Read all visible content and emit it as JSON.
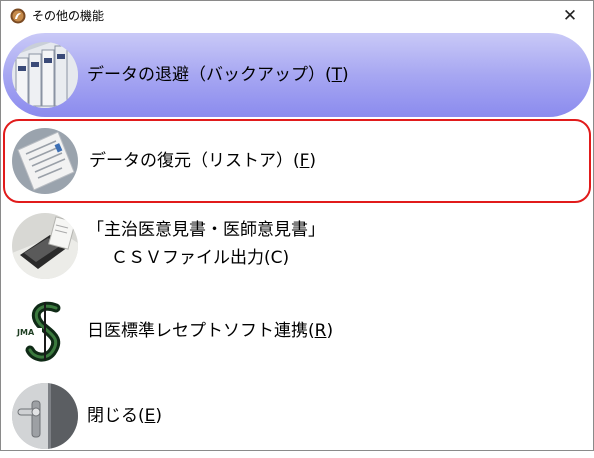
{
  "window": {
    "title": "その他の機能",
    "close_glyph": "✕"
  },
  "menu": [
    {
      "id": "backup",
      "text": "データの退避（バックアップ）(",
      "key": "T",
      "tail": ")",
      "icon": "binders-icon",
      "state": "hover"
    },
    {
      "id": "restore",
      "text": "データの復元（リストア）(",
      "key": "F",
      "tail": ")",
      "icon": "document-icon",
      "state": "selected"
    },
    {
      "id": "csv",
      "line1": "「主治医意見書・医師意見書」",
      "line2_text": "ＣＳＶファイル出力(",
      "key": "C",
      "tail": ")",
      "icon": "stapler-icon",
      "state": "normal"
    },
    {
      "id": "orca",
      "text": "日医標準レセプトソフト連携(",
      "key": "R",
      "tail": ")",
      "icon": "jma-logo-icon",
      "state": "normal"
    },
    {
      "id": "close",
      "text": "閉じる(",
      "key": "E",
      "tail": ")",
      "icon": "door-handle-icon",
      "state": "normal"
    }
  ],
  "colors": {
    "highlight_top": "#c9c9f7",
    "highlight_bottom": "#8b8bee",
    "selection_border": "#e11b1b"
  }
}
